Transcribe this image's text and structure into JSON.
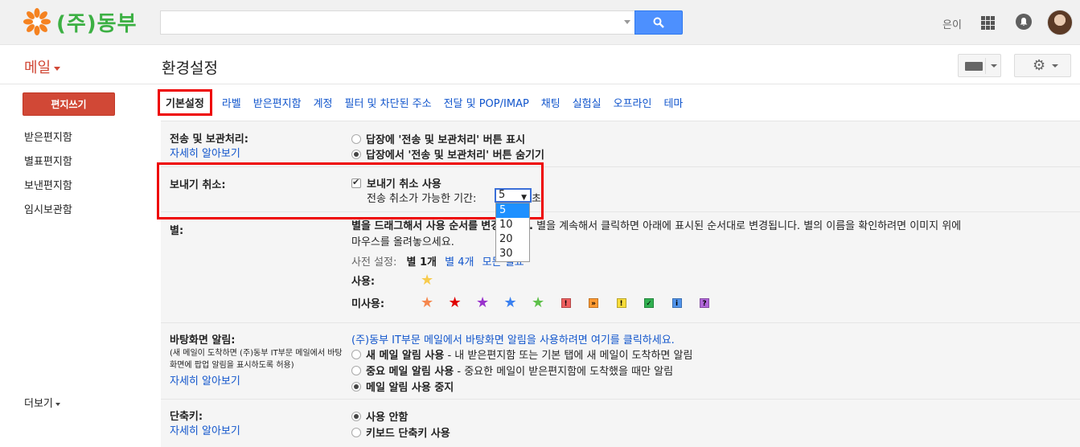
{
  "header": {
    "logo_text": "(주)동부",
    "search": {
      "value": "",
      "placeholder": ""
    },
    "user_name": "은이"
  },
  "nav": {
    "mail_label": "메일",
    "compose_label": "편지쓰기",
    "items": [
      {
        "label": "받은편지함"
      },
      {
        "label": "별표편지함"
      },
      {
        "label": "보낸편지함"
      },
      {
        "label": "임시보관함"
      }
    ],
    "more_label": "더보기"
  },
  "page": {
    "title": "환경설정"
  },
  "tabs": [
    {
      "label": "기본설정",
      "active": true
    },
    {
      "label": "라벨"
    },
    {
      "label": "받은편지함"
    },
    {
      "label": "계정"
    },
    {
      "label": "필터 및 차단된 주소"
    },
    {
      "label": "전달 및 POP/IMAP"
    },
    {
      "label": "채팅"
    },
    {
      "label": "실험실"
    },
    {
      "label": "오프라인"
    },
    {
      "label": "테마"
    }
  ],
  "settings": {
    "send_archive": {
      "label": "전송 및 보관처리:",
      "learn_more": "자세히 알아보기",
      "options": [
        {
          "label": "답장에 '전송 및 보관처리' 버튼 표시",
          "selected": false
        },
        {
          "label": "답장에서 '전송 및 보관처리' 버튼 숨기기",
          "selected": true
        }
      ]
    },
    "undo_send": {
      "label": "보내기 취소:",
      "enable_label": "보내기 취소 사용",
      "enabled": true,
      "period_label": "전송 취소가 가능한 기간:",
      "period_value": "5",
      "period_unit": "초",
      "period_options": [
        "5",
        "10",
        "20",
        "30"
      ]
    },
    "stars": {
      "label": "별:",
      "desc_prefix": "별을 드래그해서 사용 순서를",
      "desc_bold_tail": "변경하세요.",
      "desc_rest": "별을 계속해서 클릭하면 아래에 표시된 순서대로 변경됩니다. 별의 이름을 확인하려면 이미지 위에",
      "desc_line2": "마우스를 올려놓으세요.",
      "presets_label": "사전 설정:",
      "preset_1": "별 1개",
      "preset_4": "별 4개",
      "preset_all": "모든 별표",
      "in_use_label": "사용:",
      "not_in_use_label": "미사용:",
      "in_use": [
        {
          "icon": "yellow-star",
          "color": "#f7cb4d"
        }
      ],
      "not_in_use": [
        {
          "icon": "orange-star",
          "color": "#f5874e",
          "type": "star"
        },
        {
          "icon": "red-star",
          "color": "#e00000",
          "type": "star"
        },
        {
          "icon": "purple-star",
          "color": "#9932cc",
          "type": "star"
        },
        {
          "icon": "blue-star",
          "color": "#3a80f0",
          "type": "star"
        },
        {
          "icon": "green-star",
          "color": "#5ec04a",
          "type": "star"
        },
        {
          "icon": "red-bang",
          "color": "#f06060",
          "type": "box",
          "glyph": "!"
        },
        {
          "icon": "orange-guillemet",
          "color": "#ff9a31",
          "type": "box",
          "glyph": "»"
        },
        {
          "icon": "yellow-bang",
          "color": "#f7dc3a",
          "type": "box",
          "glyph": "!"
        },
        {
          "icon": "green-check",
          "color": "#30b050",
          "type": "box",
          "glyph": "✓"
        },
        {
          "icon": "blue-info",
          "color": "#5094ec",
          "type": "box",
          "glyph": "i"
        },
        {
          "icon": "purple-question",
          "color": "#b065d8",
          "type": "box",
          "glyph": "?"
        }
      ]
    },
    "desktop_notifications": {
      "label": "바탕화면 알림:",
      "note": "(새 메일이 도착하면 (주)동부 IT부문 메일에서 바탕화면에 팝업 알림을 표시하도록 허용)",
      "learn_more": "자세히 알아보기",
      "enable_link": "(주)동부 IT부문 메일에서 바탕화면 알림을 사용하려면 여기를 클릭하세요.",
      "options": [
        {
          "bold": "새 메일 알림 사용",
          "rest": " - 내 받은편지함 또는 기본 탭에 새 메일이 도착하면 알림",
          "selected": false
        },
        {
          "bold": "중요 메일 알림 사용",
          "rest": " - 중요한 메일이 받은편지함에 도착했을 때만 알림",
          "selected": false
        },
        {
          "bold": "메일 알림 사용 중지",
          "rest": "",
          "selected": true
        }
      ]
    },
    "shortcuts": {
      "label": "단축키:",
      "learn_more": "자세히 알아보기",
      "options": [
        {
          "label": "사용 안함",
          "selected": true
        },
        {
          "label": "키보드 단축키 사용",
          "selected": false
        }
      ]
    }
  },
  "colors": {
    "accent": "#d14836",
    "link": "#1155cc",
    "search_button": "#4d90fe",
    "highlight": "#ee0000",
    "logo": "#3cb043"
  }
}
